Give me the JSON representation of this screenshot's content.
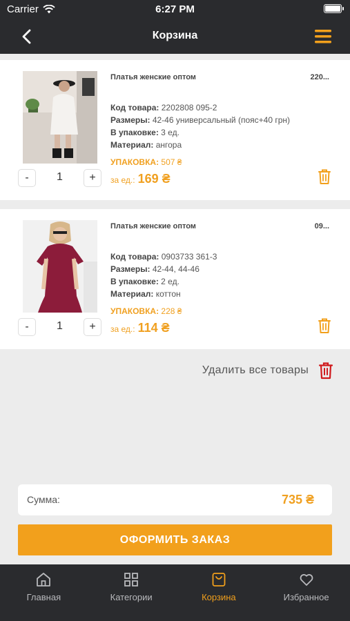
{
  "status": {
    "carrier": "Carrier",
    "time": "6:27 PM"
  },
  "nav": {
    "title": "Корзина"
  },
  "items": [
    {
      "name": "Платья женские оптом",
      "code_short": "220...",
      "specs": [
        {
          "label": "Код товара:",
          "value": "2202808  095-2"
        },
        {
          "label": "Размеры:",
          "value": "42-46 универсальный (пояс+40 грн)"
        },
        {
          "label": "В упаковке:",
          "value": "3 ед."
        },
        {
          "label": "Материал:",
          "value": "ангора"
        }
      ],
      "pack_label": "УПАКОВКА:",
      "pack_value": "507 ₴",
      "unit_label": "за ед.:",
      "unit_price": "169 ₴",
      "qty": "1",
      "minus": "-",
      "plus": "+"
    },
    {
      "name": "Платья женские оптом",
      "code_short": "09...",
      "specs": [
        {
          "label": "Код товара:",
          "value": "0903733  361-3"
        },
        {
          "label": "Размеры:",
          "value": "42-44, 44-46"
        },
        {
          "label": "В упаковке:",
          "value": "2 ед."
        },
        {
          "label": "Материал:",
          "value": "коттон"
        }
      ],
      "pack_label": "УПАКОВКА:",
      "pack_value": "228 ₴",
      "unit_label": "за ед.:",
      "unit_price": "114 ₴",
      "qty": "1",
      "minus": "-",
      "plus": "+"
    }
  ],
  "delete_all": {
    "label": "Удалить все товары"
  },
  "summary": {
    "label": "Сумма:",
    "value": "735 ₴"
  },
  "checkout": {
    "label": "ОФОРМИТЬ ЗАКАЗ"
  },
  "tabs": [
    {
      "label": "Главная",
      "icon": "home-icon"
    },
    {
      "label": "Категории",
      "icon": "grid-icon"
    },
    {
      "label": "Корзина",
      "icon": "bag-icon"
    },
    {
      "label": "Избранное",
      "icon": "heart-icon"
    }
  ],
  "colors": {
    "accent": "#f2a01c",
    "dark": "#2a2b2e",
    "danger": "#d0191c"
  }
}
